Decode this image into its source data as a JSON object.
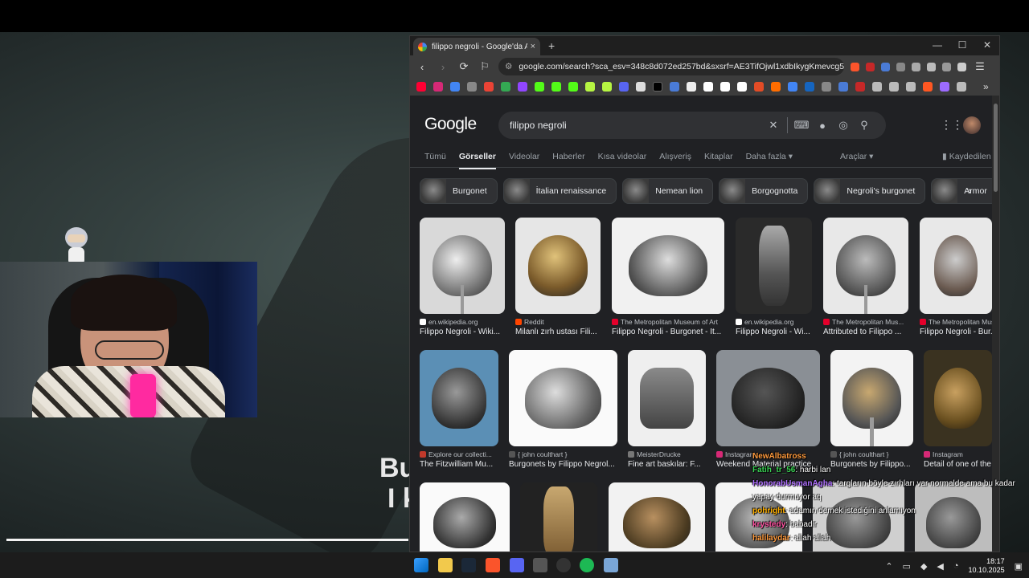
{
  "video": {
    "subtitle_line1": "Bu",
    "subtitle_line2": "I k",
    "progress": 0.4
  },
  "browser": {
    "tab_title": "filippo negroli - Google'da Ara",
    "tab_close": "×",
    "new_tab": "+",
    "minimize": "—",
    "maximize": "☐",
    "close": "✕",
    "url": "google.com/search?sca_esv=348c8d072ed257bd&sxsrf=AE3TifOjwl1xdbIkygKmevcg5KimR3_bS...",
    "more_bookmarks": "»"
  },
  "google": {
    "logo": "Google",
    "query": "filippo negroli",
    "nav_tabs": [
      "Tümü",
      "Görseller",
      "Videolar",
      "Haberler",
      "Kısa videolar",
      "Alışveriş",
      "Kitaplar",
      "Daha fazla"
    ],
    "tools": "Araçlar",
    "saved": "Kaydedilen",
    "chips": [
      "Burgonet",
      "İtalian renaissance",
      "Nemean lion",
      "Borgognotta",
      "Negroli's burgonet",
      "Armor"
    ],
    "row1": [
      {
        "source": "en.wikipedia.org",
        "title": "Filippo Negroli - Wiki..."
      },
      {
        "source": "Reddit",
        "title": "Milanlı zırh ustası Fili..."
      },
      {
        "source": "The Metropolitan Museum of Art",
        "title": "Filippo Negroli - Burgonet - It..."
      },
      {
        "source": "en.wikipedia.org",
        "title": "Filippo Negroli - Wi..."
      },
      {
        "source": "The Metropolitan Mus...",
        "title": "Attributed to Filippo ..."
      },
      {
        "source": "The Metropolitan Mus...",
        "title": "Filippo Negroli - Bur..."
      }
    ],
    "row2": [
      {
        "source": "Explore our collecti...",
        "title": "The Fitzwilliam Mu..."
      },
      {
        "source": "{ john coulthart }",
        "title": "Burgonets by Filippo Negrol..."
      },
      {
        "source": "MeisterDrucke",
        "title": "Fine art baskılar: F..."
      },
      {
        "source": "Instagram",
        "title": "Weekend Material practice"
      },
      {
        "source": "{ john coulthart }",
        "title": "Burgonets by Filippo..."
      },
      {
        "source": "Instagram",
        "title": "Detail of one of the"
      }
    ]
  },
  "chat": [
    {
      "user": "NewAlbatross",
      "user_color": "#ff9a3c",
      "text": ""
    },
    {
      "user": "Fatih_tr_56",
      "user_color": "#39d353",
      "text": ": harbi lan"
    },
    {
      "user": "HonorabUsmanAgha",
      "user_color": "#b070ff",
      "text": ": targların böyle zırhları var normalde ama bu kadar yapay durmuyor aq"
    },
    {
      "user": "pohright",
      "user_color": "#ffb000",
      "text": ": adamın demek istediğini anlamıyon"
    },
    {
      "user": "krystedy",
      "user_color": "#ff4fa0",
      "text": ": babadir"
    },
    {
      "user": "halilaydar",
      "user_color": "#ff9a3c",
      "text": ": allah allah"
    }
  ],
  "taskbar": {
    "time": "18:17",
    "date": "10.10.2025"
  }
}
